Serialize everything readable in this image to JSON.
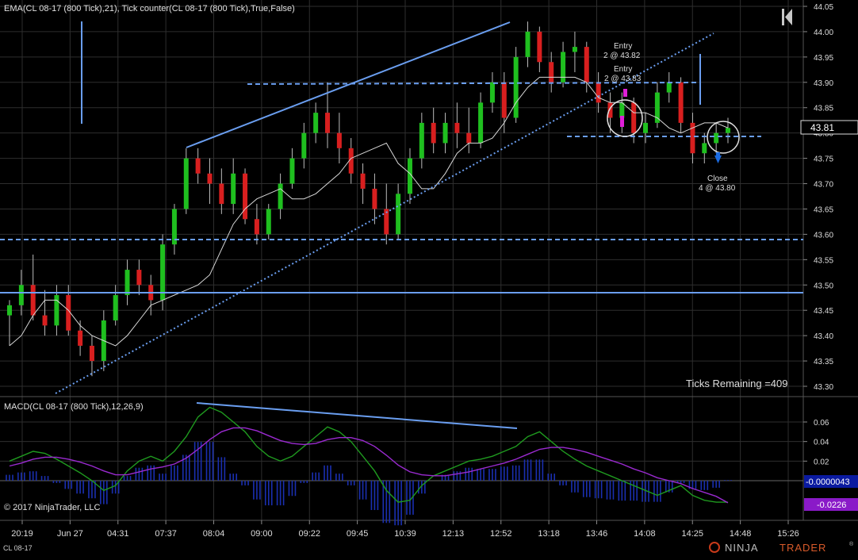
{
  "colors": {
    "background": "#000000",
    "grid": "#2e2e2e",
    "up_candle": "#1fbf1f",
    "down_candle": "#d81f1f",
    "ema": "#d8d8d8",
    "drawing": "#6a9ef0",
    "macd_line": "#1f9a1f",
    "macd_avg": "#9a2ad0",
    "macd_hist": "#1a2fb0",
    "price_tag_bg": "#000000",
    "macd_tag_bg": "#0a1aa0",
    "avg_tag_bg": "#8a1ac8",
    "entry_marker": "#e01fd8",
    "exit_marker": "#1a6ae0"
  },
  "header": {
    "indicator_label": "EMA(CL 08-17 (800 Tick),21), Tick counter(CL 08-17 (800 Tick),True,False)",
    "go_to_start_icon": "skip-to-start-icon"
  },
  "price_panel": {
    "y_ticks": [
      "44.05",
      "44.00",
      "43.95",
      "43.90",
      "43.85",
      "43.80",
      "43.75",
      "43.70",
      "43.65",
      "43.60",
      "43.55",
      "43.50",
      "43.45",
      "43.40",
      "43.35",
      "43.30"
    ],
    "last_price": "43.81",
    "tick_counter_text": "Ticks Remaining =409",
    "annotations": [
      {
        "label": "Entry",
        "detail": "2 @ 43.82"
      },
      {
        "label": "Entry",
        "detail": "2 @ 43.83"
      },
      {
        "label": "Close",
        "detail": "4 @ 43.80"
      }
    ]
  },
  "macd_panel": {
    "label": "MACD(CL 08-17 (800 Tick),12,26,9)",
    "y_ticks": [
      "0.06",
      "0.04",
      "0.02"
    ],
    "macd_value": "-0.0000043",
    "avg_value": "-0.0226",
    "copyright": "© 2017 NinjaTrader, LLC"
  },
  "x_axis": {
    "ticks": [
      "20:19",
      "Jun 27",
      "04:31",
      "07:37",
      "08:04",
      "09:00",
      "09:22",
      "09:45",
      "10:39",
      "12:13",
      "12:52",
      "13:18",
      "13:46",
      "14:08",
      "14:25",
      "14:48",
      "15:26"
    ]
  },
  "footer": {
    "instrument": "CL 08-17",
    "brand_prefix": "NINJA",
    "brand_suffix": "TRADER",
    "registered": "®"
  },
  "chart_data": [
    {
      "type": "candlestick",
      "title": "CL 08-17 (800 Tick)",
      "ylim": [
        43.28,
        44.06
      ],
      "series": [
        {
          "name": "EMA(21)",
          "values": [
            43.38,
            43.4,
            43.44,
            43.47,
            43.47,
            43.45,
            43.42,
            43.4,
            43.39,
            43.38,
            43.4,
            43.43,
            43.46,
            43.47,
            43.48,
            43.49,
            43.5,
            43.52,
            43.57,
            43.62,
            43.65,
            43.67,
            43.68,
            43.69,
            43.67,
            43.67,
            43.68,
            43.7,
            43.72,
            43.75,
            43.76,
            43.77,
            43.78,
            43.74,
            43.72,
            43.69,
            43.69,
            43.72,
            43.76,
            43.78,
            43.78,
            43.79,
            43.82,
            43.86,
            43.89,
            43.91,
            43.91,
            43.91,
            43.91,
            43.9,
            43.87,
            43.86,
            43.86,
            43.84,
            43.84,
            43.83,
            43.81,
            43.8,
            43.81,
            43.82,
            43.82,
            43.81
          ]
        }
      ],
      "ohlc": [
        [
          43.44,
          43.47,
          43.38,
          43.46
        ],
        [
          43.46,
          43.53,
          43.44,
          43.5
        ],
        [
          43.5,
          43.56,
          43.43,
          43.44
        ],
        [
          43.44,
          43.49,
          43.4,
          43.42
        ],
        [
          43.42,
          43.5,
          43.4,
          43.48
        ],
        [
          43.48,
          43.5,
          43.4,
          43.41
        ],
        [
          43.41,
          43.43,
          43.36,
          43.38
        ],
        [
          43.38,
          43.4,
          43.32,
          43.35
        ],
        [
          43.35,
          43.45,
          43.33,
          43.43
        ],
        [
          43.43,
          43.5,
          43.42,
          43.48
        ],
        [
          43.48,
          43.55,
          43.46,
          43.53
        ],
        [
          43.53,
          43.55,
          43.48,
          43.5
        ],
        [
          43.5,
          43.52,
          43.44,
          43.47
        ],
        [
          43.47,
          43.6,
          43.45,
          43.58
        ],
        [
          43.58,
          43.66,
          43.56,
          43.65
        ],
        [
          43.65,
          43.77,
          43.64,
          43.75
        ],
        [
          43.75,
          43.77,
          43.7,
          43.72
        ],
        [
          43.72,
          43.75,
          43.66,
          43.7
        ],
        [
          43.7,
          43.73,
          43.64,
          43.66
        ],
        [
          43.66,
          43.75,
          43.64,
          43.72
        ],
        [
          43.72,
          43.73,
          43.62,
          43.63
        ],
        [
          43.63,
          43.66,
          43.58,
          43.6
        ],
        [
          43.6,
          43.66,
          43.59,
          43.65
        ],
        [
          43.65,
          43.72,
          43.63,
          43.7
        ],
        [
          43.7,
          43.77,
          43.69,
          43.75
        ],
        [
          43.75,
          43.82,
          43.73,
          43.8
        ],
        [
          43.8,
          43.86,
          43.78,
          43.84
        ],
        [
          43.84,
          43.9,
          43.77,
          43.8
        ],
        [
          43.8,
          43.84,
          43.74,
          43.77
        ],
        [
          43.77,
          43.79,
          43.7,
          43.72
        ],
        [
          43.72,
          43.74,
          43.66,
          43.69
        ],
        [
          43.69,
          43.72,
          43.62,
          43.65
        ],
        [
          43.65,
          43.7,
          43.58,
          43.6
        ],
        [
          43.6,
          43.7,
          43.59,
          43.68
        ],
        [
          43.68,
          43.77,
          43.66,
          43.75
        ],
        [
          43.75,
          43.84,
          43.73,
          43.82
        ],
        [
          43.82,
          43.85,
          43.76,
          43.78
        ],
        [
          43.78,
          43.84,
          43.76,
          43.82
        ],
        [
          43.82,
          43.86,
          43.77,
          43.8
        ],
        [
          43.8,
          43.85,
          43.76,
          43.78
        ],
        [
          43.78,
          43.88,
          43.77,
          43.86
        ],
        [
          43.86,
          43.92,
          43.84,
          43.9
        ],
        [
          43.9,
          43.92,
          43.8,
          43.83
        ],
        [
          43.83,
          43.97,
          43.82,
          43.95
        ],
        [
          43.95,
          44.02,
          43.93,
          44.0
        ],
        [
          44.0,
          44.01,
          43.92,
          43.94
        ],
        [
          43.94,
          43.96,
          43.88,
          43.9
        ],
        [
          43.9,
          43.98,
          43.89,
          43.96
        ],
        [
          43.96,
          44.0,
          43.92,
          43.97
        ],
        [
          43.97,
          43.98,
          43.88,
          43.9
        ],
        [
          43.9,
          43.92,
          43.84,
          43.86
        ],
        [
          43.86,
          43.88,
          43.8,
          43.83
        ],
        [
          43.83,
          43.88,
          43.8,
          43.86
        ],
        [
          43.86,
          43.87,
          43.78,
          43.8
        ],
        [
          43.8,
          43.84,
          43.78,
          43.82
        ],
        [
          43.82,
          43.9,
          43.81,
          43.88
        ],
        [
          43.88,
          43.92,
          43.86,
          43.9
        ],
        [
          43.9,
          43.91,
          43.8,
          43.82
        ],
        [
          43.82,
          43.84,
          43.74,
          43.76
        ],
        [
          43.76,
          43.8,
          43.74,
          43.78
        ],
        [
          43.78,
          43.82,
          43.76,
          43.8
        ],
        [
          43.8,
          43.83,
          43.78,
          43.81
        ]
      ]
    },
    {
      "type": "line",
      "title": "MACD(CL 08-17 (800 Tick),12,26,9)",
      "ylim": [
        -0.03,
        0.08
      ],
      "series": [
        {
          "name": "MACD",
          "values": [
            0.02,
            0.025,
            0.03,
            0.028,
            0.022,
            0.015,
            0.008,
            0.0,
            -0.01,
            -0.005,
            0.01,
            0.02,
            0.025,
            0.02,
            0.03,
            0.045,
            0.065,
            0.075,
            0.07,
            0.06,
            0.05,
            0.035,
            0.025,
            0.02,
            0.025,
            0.035,
            0.045,
            0.055,
            0.05,
            0.04,
            0.025,
            0.01,
            -0.01,
            -0.022,
            -0.02,
            -0.005,
            0.005,
            0.01,
            0.015,
            0.02,
            0.022,
            0.025,
            0.03,
            0.035,
            0.045,
            0.05,
            0.04,
            0.03,
            0.022,
            0.015,
            0.01,
            0.005,
            0.0,
            -0.005,
            -0.01,
            -0.015,
            -0.01,
            -0.005,
            -0.015,
            -0.02,
            -0.022,
            -0.022
          ]
        },
        {
          "name": "Avg",
          "values": [
            0.015,
            0.018,
            0.022,
            0.024,
            0.024,
            0.022,
            0.019,
            0.015,
            0.01,
            0.006,
            0.006,
            0.009,
            0.012,
            0.014,
            0.017,
            0.023,
            0.032,
            0.042,
            0.05,
            0.054,
            0.054,
            0.051,
            0.046,
            0.041,
            0.038,
            0.037,
            0.038,
            0.042,
            0.044,
            0.044,
            0.041,
            0.035,
            0.026,
            0.016,
            0.009,
            0.006,
            0.005,
            0.005,
            0.007,
            0.009,
            0.012,
            0.015,
            0.018,
            0.022,
            0.027,
            0.032,
            0.034,
            0.034,
            0.032,
            0.029,
            0.025,
            0.021,
            0.017,
            0.012,
            0.008,
            0.003,
            0.0,
            -0.003,
            -0.008,
            -0.012,
            -0.016,
            -0.0226
          ]
        }
      ]
    }
  ]
}
